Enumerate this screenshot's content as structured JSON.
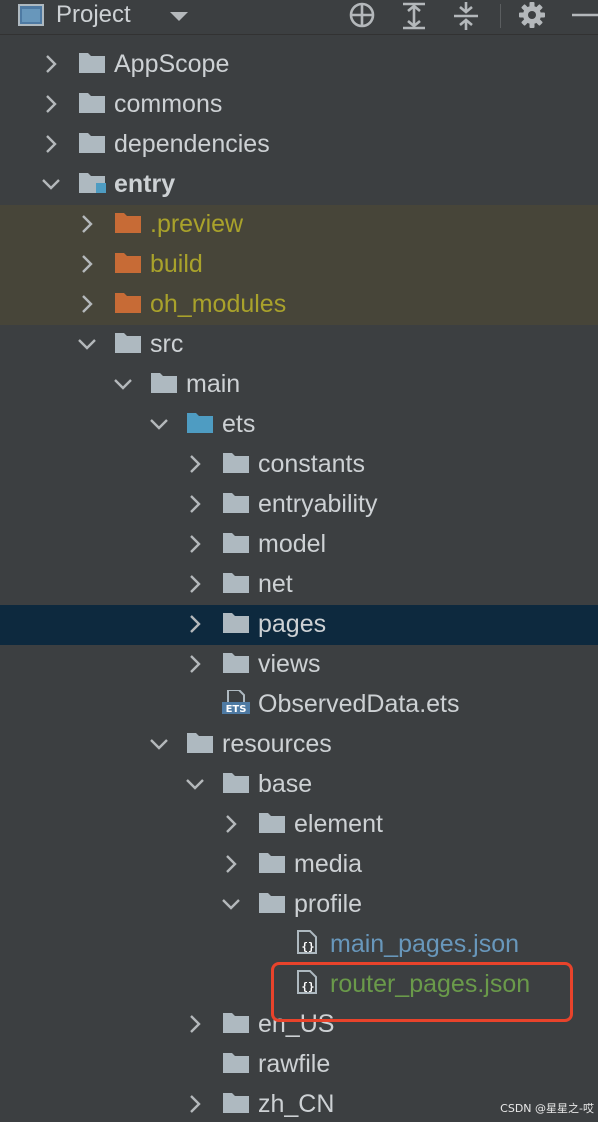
{
  "toolbar": {
    "title": "Project",
    "view_icon": "project-view-icon",
    "buttons": [
      "locate-icon",
      "expand-all-icon",
      "collapse-all-icon",
      "gear-icon",
      "hide-icon"
    ]
  },
  "tree": [
    {
      "id": "appscope",
      "label": "AppScope",
      "depth": 0,
      "expanded": false,
      "icon": "folder"
    },
    {
      "id": "commons",
      "label": "commons",
      "depth": 0,
      "expanded": false,
      "icon": "folder"
    },
    {
      "id": "dependencies",
      "label": "dependencies",
      "depth": 0,
      "expanded": false,
      "icon": "folder"
    },
    {
      "id": "entry",
      "label": "entry",
      "depth": 0,
      "expanded": true,
      "icon": "module-folder"
    },
    {
      "id": "preview",
      "label": ".preview",
      "depth": 1,
      "expanded": false,
      "icon": "excluded-folder"
    },
    {
      "id": "build",
      "label": "build",
      "depth": 1,
      "expanded": false,
      "icon": "excluded-folder"
    },
    {
      "id": "oh-modules",
      "label": "oh_modules",
      "depth": 1,
      "expanded": false,
      "icon": "excluded-folder"
    },
    {
      "id": "src",
      "label": "src",
      "depth": 1,
      "expanded": true,
      "icon": "folder"
    },
    {
      "id": "main",
      "label": "main",
      "depth": 2,
      "expanded": true,
      "icon": "folder"
    },
    {
      "id": "ets",
      "label": "ets",
      "depth": 3,
      "expanded": true,
      "icon": "source-folder"
    },
    {
      "id": "constants",
      "label": "constants",
      "depth": 4,
      "expanded": false,
      "icon": "folder"
    },
    {
      "id": "entryability",
      "label": "entryability",
      "depth": 4,
      "expanded": false,
      "icon": "folder"
    },
    {
      "id": "model",
      "label": "model",
      "depth": 4,
      "expanded": false,
      "icon": "folder"
    },
    {
      "id": "net",
      "label": "net",
      "depth": 4,
      "expanded": false,
      "icon": "folder"
    },
    {
      "id": "pages",
      "label": "pages",
      "depth": 4,
      "expanded": false,
      "icon": "folder"
    },
    {
      "id": "views",
      "label": "views",
      "depth": 4,
      "expanded": false,
      "icon": "folder"
    },
    {
      "id": "observeddata",
      "label": "ObservedData.ets",
      "depth": 4,
      "icon": "ets-file"
    },
    {
      "id": "resources",
      "label": "resources",
      "depth": 3,
      "expanded": true,
      "icon": "folder"
    },
    {
      "id": "base",
      "label": "base",
      "depth": 4,
      "expanded": true,
      "icon": "folder"
    },
    {
      "id": "element",
      "label": "element",
      "depth": 5,
      "expanded": false,
      "icon": "folder"
    },
    {
      "id": "media",
      "label": "media",
      "depth": 5,
      "expanded": false,
      "icon": "folder"
    },
    {
      "id": "profile",
      "label": "profile",
      "depth": 5,
      "expanded": true,
      "icon": "folder"
    },
    {
      "id": "main-pages-json",
      "label": "main_pages.json",
      "depth": 6,
      "icon": "json-file"
    },
    {
      "id": "router-pages-json",
      "label": "router_pages.json",
      "depth": 6,
      "icon": "json-file"
    },
    {
      "id": "en-us",
      "label": "en_US",
      "depth": 4,
      "expanded": false,
      "icon": "folder"
    },
    {
      "id": "rawfile",
      "label": "rawfile",
      "depth": 4,
      "icon": "folder"
    },
    {
      "id": "zh-cn",
      "label": "zh_CN",
      "depth": 4,
      "expanded": false,
      "icon": "folder"
    }
  ],
  "selected": "pages",
  "highlighted_excluded": [
    ".preview",
    "build",
    "oh_modules"
  ],
  "annotation": {
    "target": "router_pages.json",
    "color": "#e8432b"
  },
  "colors": {
    "background": "#3c3f41",
    "text": "#cdd1d4",
    "excluded_text": "#a9a22b",
    "excluded_row": "#474539",
    "selected_row": "#0d293e",
    "modified_blue": "#6897bb",
    "added_green": "#6a9a4a",
    "folder": "#aeb9c0",
    "excluded_folder": "#c76b36",
    "source_folder": "#4e9cc2"
  },
  "watermark": "CSDN @星星之-哎"
}
